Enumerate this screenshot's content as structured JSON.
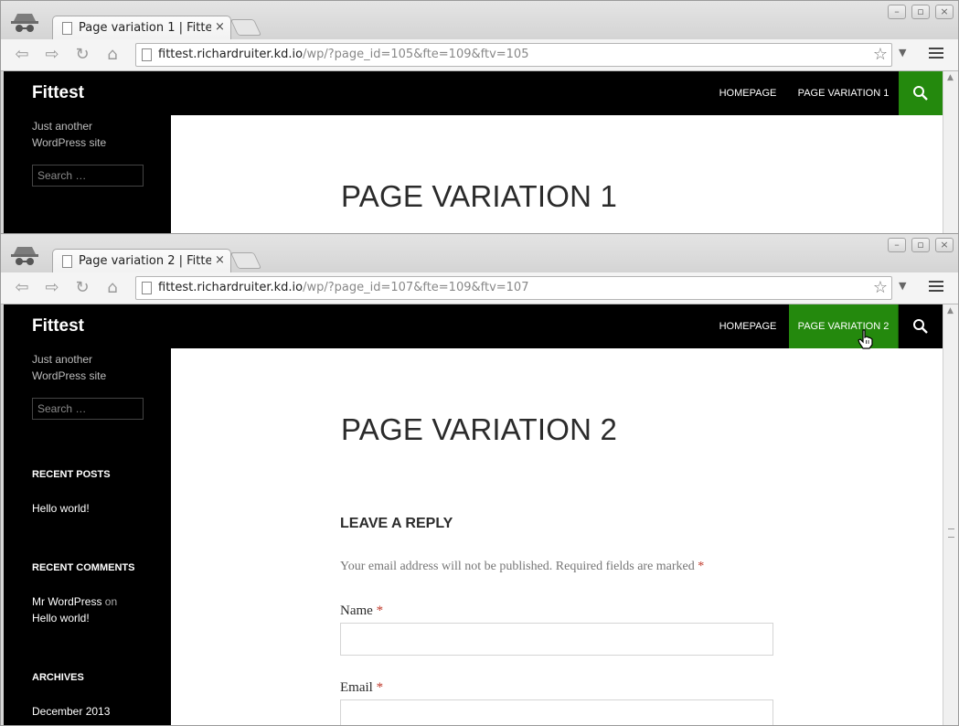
{
  "window1": {
    "tab_title": "Page variation 1 | Fittes",
    "tab_close": "×",
    "url_host": "fittest.richardruiter.kd.io",
    "url_rest": "/wp/?page_id=105&fte=109&ftv=105",
    "site_title": "Fittest",
    "nav": [
      "HOMEPAGE",
      "PAGE VARIATION 1"
    ],
    "tagline": "Just another WordPress site",
    "search_placeholder": "Search …",
    "page_title": "PAGE VARIATION 1"
  },
  "window2": {
    "tab_title": "Page variation 2 | Fittes",
    "tab_close": "×",
    "url_host": "fittest.richardruiter.kd.io",
    "url_rest": "/wp/?page_id=107&fte=109&ftv=107",
    "site_title": "Fittest",
    "nav": [
      "HOMEPAGE",
      "PAGE VARIATION 2"
    ],
    "tagline": "Just another WordPress site",
    "search_placeholder": "Search …",
    "page_title": "PAGE VARIATION 2",
    "widgets": {
      "recent_posts_title": "RECENT POSTS",
      "recent_post": "Hello world!",
      "recent_comments_title": "RECENT COMMENTS",
      "comment_author": "Mr WordPress",
      "comment_on": "on",
      "comment_post": "Hello world!",
      "archives_title": "ARCHIVES",
      "archive_item": "December 2013"
    },
    "reply": {
      "title": "LEAVE A REPLY",
      "note": "Your email address will not be published. Required fields are marked",
      "required_mark": "*",
      "name_label": "Name",
      "email_label": "Email"
    }
  },
  "colors": {
    "accent": "#24890d",
    "header_bg": "#000000"
  },
  "icons": [
    "incognito-icon",
    "page-icon",
    "back-icon",
    "forward-icon",
    "reload-icon",
    "home-icon",
    "star-icon",
    "menu-icon",
    "search-icon",
    "hand-cursor-icon"
  ]
}
